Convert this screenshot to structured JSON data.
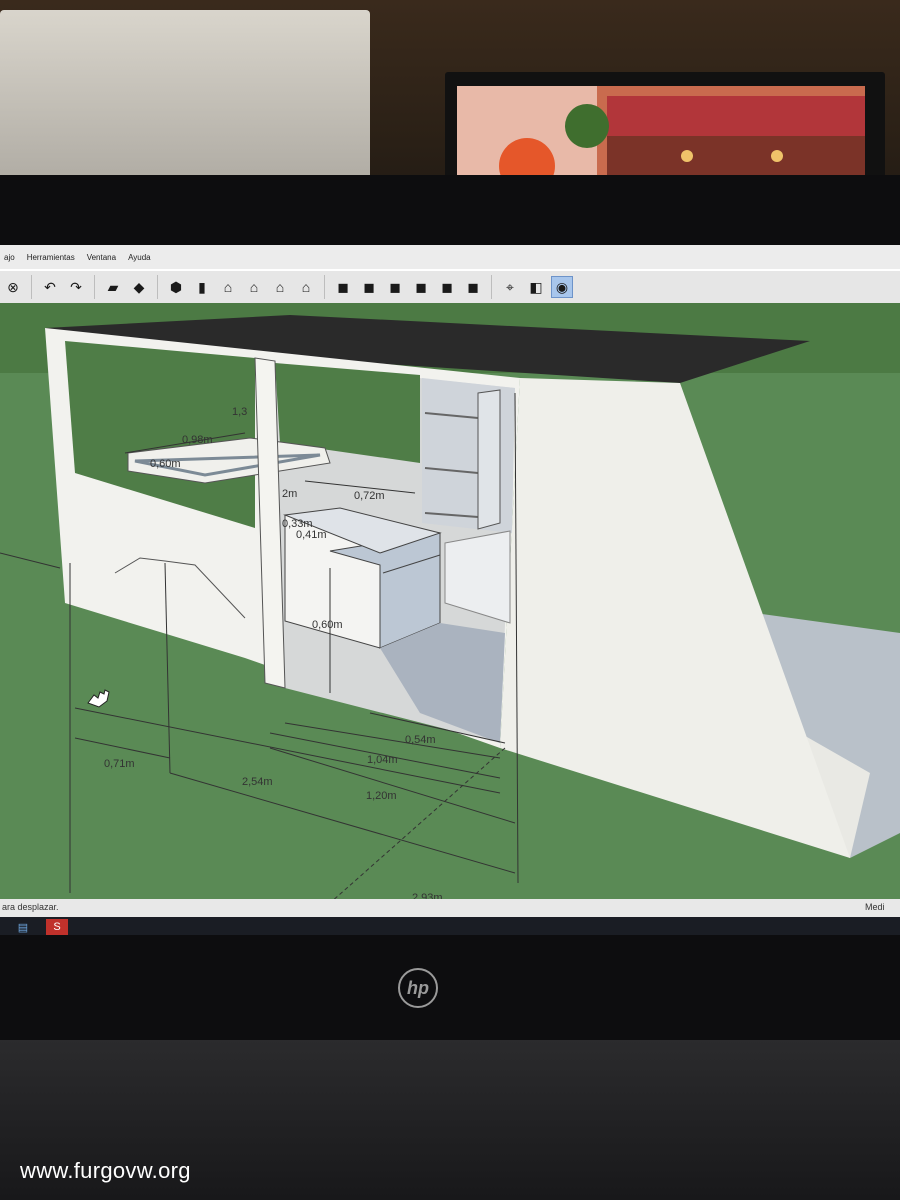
{
  "menu": [
    "ajo",
    "Herramientas",
    "Ventana",
    "Ayuda"
  ],
  "toolbar_icons": [
    "eraser-icon",
    "undo-icon",
    "redo-icon",
    "model-info-icon",
    "components-icon",
    "iso-view-icon",
    "top-view-icon",
    "front-view-icon",
    "right-view-icon",
    "back-view-icon",
    "left-view-icon",
    "xray-icon",
    "wireframe-icon",
    "hidden-line-icon",
    "shaded-icon",
    "textured-icon",
    "monochrome-icon",
    "position-camera-icon",
    "walk-icon",
    "look-around-icon"
  ],
  "dimensions": {
    "d1_3": "1,3",
    "d0_98": "0,98m",
    "d0_60a": "0,60m",
    "d2m": "2m",
    "d0_72": "0,72m",
    "d0_33": "0,33m",
    "d0_41": "0,41m",
    "d0_60": "0,60m",
    "d0_54": "0,54m",
    "d1_04": "1,04m",
    "d0_71": "0,71m",
    "d2_54": "2,54m",
    "d1_20": "1,20m",
    "d2_93": "2,93m"
  },
  "status": {
    "left": "ara desplazar.",
    "right": "Medi"
  },
  "taskbar": {
    "icons": [
      "windows-explorer-icon",
      "sketchup-icon"
    ]
  },
  "hp_logo": "hp",
  "watermark": "www.furgovw.org",
  "colors": {
    "ground": "#5c8f5a",
    "sky_green": "#4f7d47",
    "wall": "#efefea",
    "roof": "#2a2a2a",
    "highlight": "#a8c6ec"
  }
}
